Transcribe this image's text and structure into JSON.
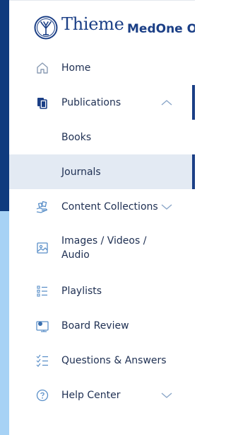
{
  "header": {
    "brand": "Thieme",
    "product": "MedOne Oto"
  },
  "nav": {
    "home": {
      "label": "Home",
      "icon": "home-icon"
    },
    "publications": {
      "label": "Publications",
      "icon": "books-icon",
      "expanded": true
    },
    "books": {
      "label": "Books"
    },
    "journals": {
      "label": "Journals",
      "selected": true
    },
    "content_collections": {
      "label": "Content Collections",
      "icon": "hand-collection-icon"
    },
    "images_videos_audio": {
      "label": "Images / Videos / Audio",
      "icon": "image-icon"
    },
    "playlists": {
      "label": "Playlists",
      "icon": "list-icon"
    },
    "board_review": {
      "label": "Board Review",
      "icon": "board-review-icon"
    },
    "qa": {
      "label": "Questions & Answers",
      "icon": "checklist-icon"
    },
    "help_center": {
      "label": "Help Center",
      "icon": "help-icon"
    }
  },
  "colors": {
    "brand_dark": "#0f3b7e",
    "brand_light": "#a7d2f5",
    "selected_bg": "#e3eaf3",
    "icon": "#4a88c6",
    "text": "#1e2f52"
  }
}
